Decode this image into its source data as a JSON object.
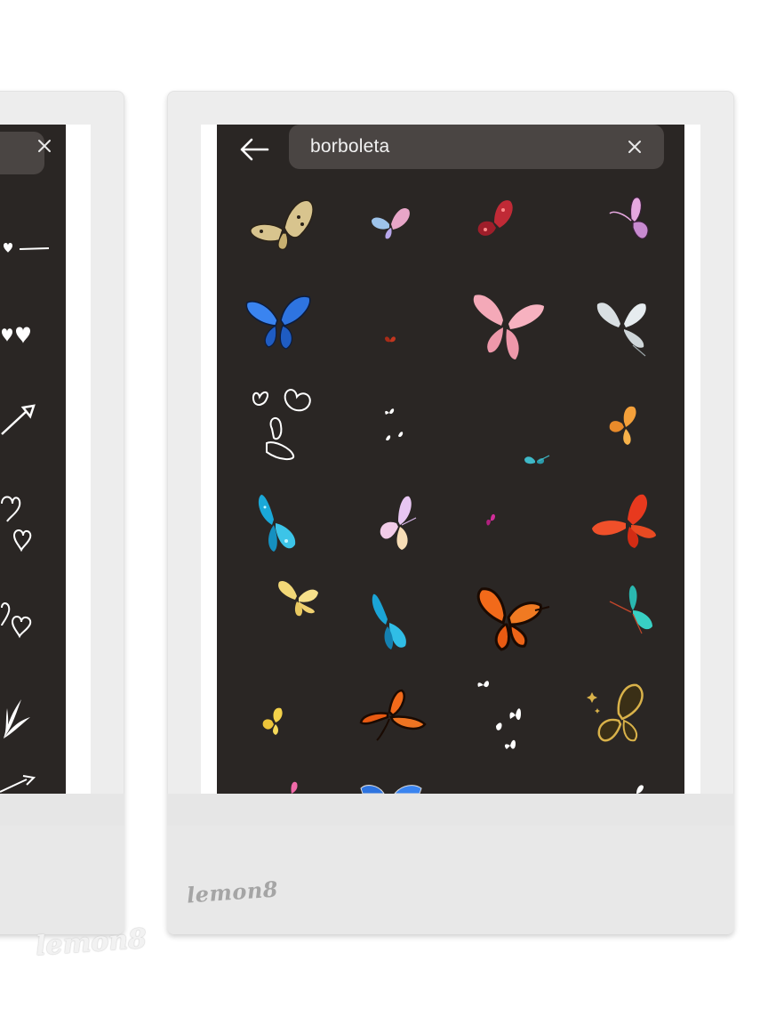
{
  "search": {
    "query": "borboleta"
  },
  "watermarks": {
    "frame": "lemon8",
    "corner": "lemon8"
  },
  "icons": {
    "back": "arrow-left-icon",
    "clear": "close-icon"
  },
  "stickers": [
    "butterfly-gold-sketch",
    "butterfly-pink-blue",
    "butterfly-red",
    "butterfly-purple-outline",
    "butterfly-blue",
    "butterfly-tiny-red",
    "butterfly-pink",
    "butterfly-white",
    "butterfly-line-art",
    "butterfly-tiny-white-pair",
    "butterfly-orange-small",
    "butterfly-teal-small",
    "butterfly-blue-glow",
    "butterfly-holo",
    "butterfly-tiny-magenta",
    "butterfly-red-orange",
    "butterfly-yellow",
    "butterfly-blue-side",
    "butterfly-monarch",
    "butterfly-teal-side",
    "butterfly-yellow-small",
    "butterfly-monarch-small",
    "butterfly-white-flock",
    "butterfly-gold-outline"
  ],
  "colors": {
    "screen_bg": "#2a2624",
    "search_bg": "#4a4543",
    "frame_bg": "#ededed"
  }
}
